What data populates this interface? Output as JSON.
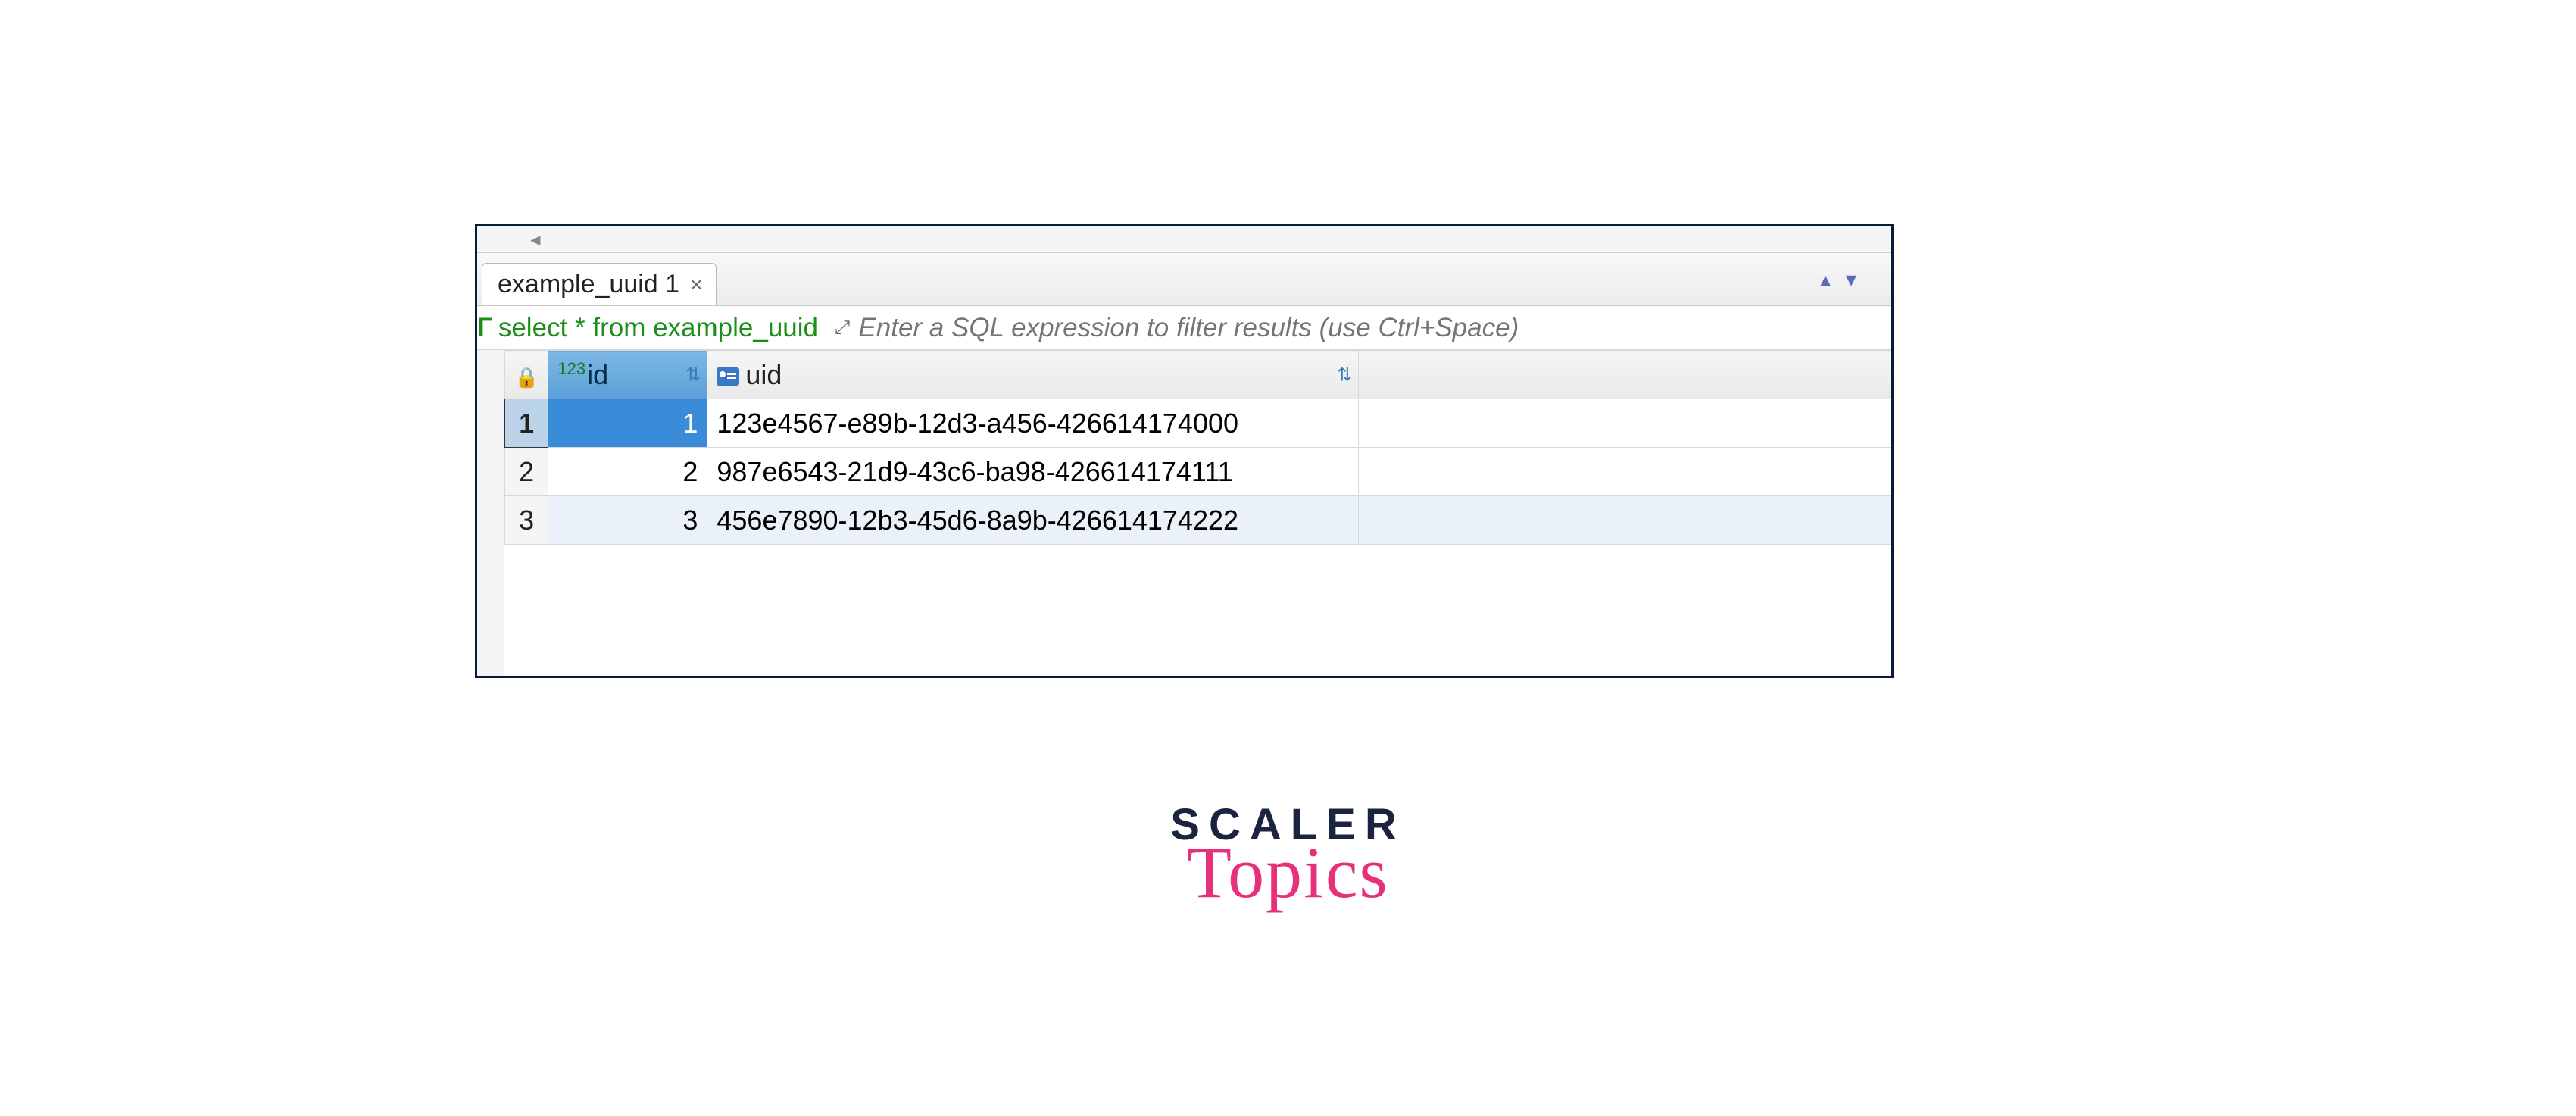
{
  "tab": {
    "label": "example_uuid 1"
  },
  "query": {
    "text": "select * from example_uuid"
  },
  "filter": {
    "placeholder": "Enter a SQL expression to filter results (use Ctrl+Space)"
  },
  "columns": {
    "id": {
      "type_prefix": "123",
      "label": "id"
    },
    "uid": {
      "label": "uid"
    }
  },
  "rows": [
    {
      "n": "1",
      "id": "1",
      "uid": "123e4567-e89b-12d3-a456-426614174000"
    },
    {
      "n": "2",
      "id": "2",
      "uid": "987e6543-21d9-43c6-ba98-426614174111"
    },
    {
      "n": "3",
      "id": "3",
      "uid": "456e7890-12b3-45d6-8a9b-426614174222"
    }
  ],
  "logo": {
    "line1": "SCALER",
    "line2": "Topics"
  }
}
